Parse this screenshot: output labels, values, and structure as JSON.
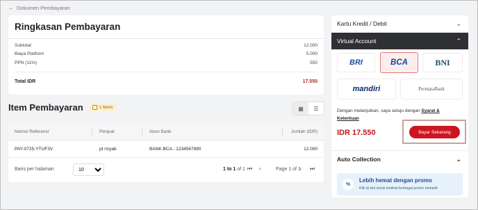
{
  "breadcrumb": {
    "label": "Dokumen Pembayaran"
  },
  "summary": {
    "title": "Ringkasan Pembayaran",
    "rows": [
      {
        "label": "Subtotal",
        "value": "12.000"
      },
      {
        "label": "Biaya Platform",
        "value": "5.000"
      },
      {
        "label": "PPN (11%)",
        "value": "550"
      }
    ],
    "total_label": "Total IDR",
    "total_value": "17.550"
  },
  "items": {
    "title": "Item Pembayaran",
    "badge": "1 Items",
    "columns": [
      "Nomor Referensi",
      "Penjual",
      "Akun Bank",
      "Jumlah (IDR)"
    ],
    "rows": [
      {
        "ref": "PAY-0725-YTUF3V",
        "seller": "pt rizyab",
        "bank": "BANK BCA - 1234567890",
        "amount": "12.000"
      }
    ],
    "pager": {
      "rows_label": "Baris per halaman",
      "rows_value": "10",
      "range_prefix": "1 to 1",
      "range_suffix": "of 1",
      "page_text": "Page 1 of 1"
    }
  },
  "payment": {
    "card_label": "Kartu Kredit / Debit",
    "va_label": "Virtual Account",
    "banks": {
      "bri": "BRI",
      "bca": "BCA",
      "bni": "BNI",
      "mandiri": "mandiri",
      "permata": "PermataBank"
    },
    "agree_text": "Dengan melanjutkan, saya setuju dengan ",
    "agree_link": "Syarat & Ketentuan",
    "amount": "IDR 17.550",
    "pay_button": "Bayar Sekarang",
    "auto_label": "Auto Collection",
    "promo_title": "Lebih hemat dengan promo",
    "promo_sub": "Klik di sini untuk melihat berbagai promo menarik",
    "promo_icon": "%"
  },
  "colors": {
    "accent": "#cf1420",
    "dark": "#2f3033",
    "promo_bg": "#e6f1fb"
  }
}
